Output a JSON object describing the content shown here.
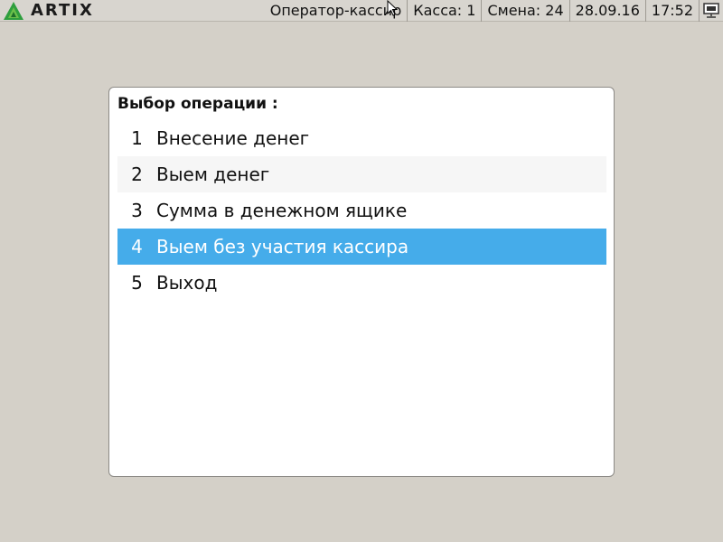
{
  "app": {
    "logo_text": "ARTIX"
  },
  "status": {
    "operator": "Оператор-кассир",
    "register": "Касса: 1",
    "shift": "Смена: 24",
    "date": "28.09.16",
    "time": "17:52"
  },
  "panel": {
    "title": "Выбор операции :",
    "items": [
      {
        "num": "1",
        "label": "Внесение денег"
      },
      {
        "num": "2",
        "label": "Выем денег"
      },
      {
        "num": "3",
        "label": "Сумма в денежном ящике"
      },
      {
        "num": "4",
        "label": "Выем без участия кассира"
      },
      {
        "num": "5",
        "label": "Выход"
      }
    ],
    "selected_index": 3
  },
  "colors": {
    "selected": "#45acea",
    "background": "#d4d0c8",
    "logo_green": "#2e9e3e"
  },
  "icons": {
    "logo": "artix-logo-icon",
    "network": "network-status-icon",
    "cursor": "mouse-cursor-icon"
  }
}
